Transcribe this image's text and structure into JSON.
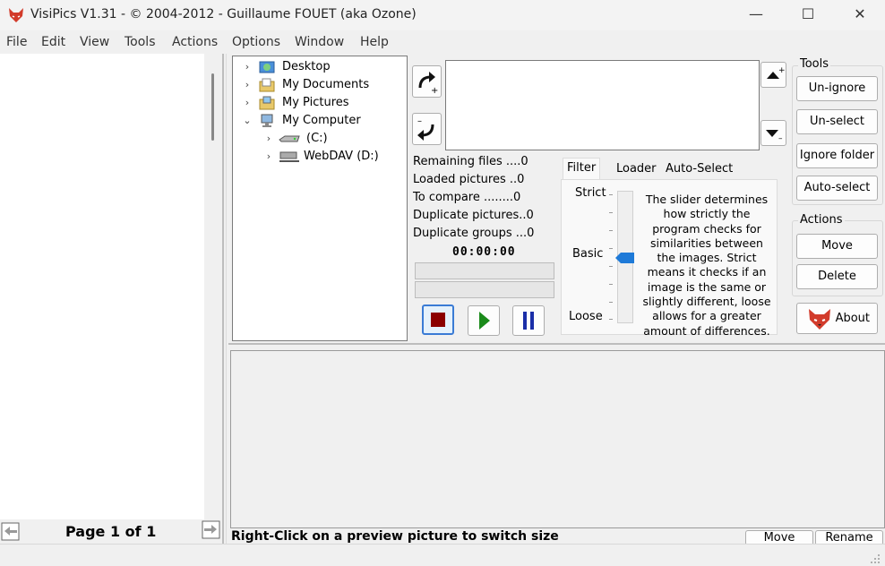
{
  "window": {
    "title": "VisiPics V1.31 - © 2004-2012 - Guillaume FOUET (aka Ozone)",
    "minimize_glyph": "—",
    "maximize_glyph": "☐",
    "close_glyph": "✕"
  },
  "menu": [
    "File",
    "Edit",
    "View",
    "Tools",
    "Actions",
    "Options",
    "Window",
    "Help"
  ],
  "tree": [
    {
      "label": "Desktop",
      "chevron": "›"
    },
    {
      "label": "My Documents",
      "chevron": "›"
    },
    {
      "label": "My Pictures",
      "chevron": "›"
    },
    {
      "label": "My Computer",
      "chevron": "⌄"
    },
    {
      "label": "(C:)",
      "chevron": "›"
    },
    {
      "label": "WebDAV (D:)",
      "chevron": "›"
    }
  ],
  "stats": {
    "remaining": "Remaining files ....0",
    "loaded": "Loaded pictures ..0",
    "compare": "To compare ........0",
    "duplicates": "Duplicate pictures..0",
    "groups": "Duplicate groups ...0",
    "timer": "00:00:00"
  },
  "filter": {
    "tabs": [
      "Filter",
      "Loader",
      "Auto-Select"
    ],
    "levels": {
      "strict": "Strict",
      "basic": "Basic",
      "loose": "Loose"
    },
    "slider_level": "Basic",
    "description": "The slider determines how strictly the program checks for similarities between the images. Strict means it checks if an image is the same or slightly different, loose allows for a greater amount of differences."
  },
  "tools": {
    "label": "Tools",
    "unignore": "Un-ignore",
    "unselect": "Un-select",
    "ignore_folder": "Ignore folder",
    "autoselect": "Auto-select"
  },
  "actions": {
    "label": "Actions",
    "move": "Move",
    "delete": "Delete",
    "about": "About"
  },
  "left_footer": {
    "page": "Page 1 of 1"
  },
  "status": {
    "hint": "Right-Click on a preview picture to switch size",
    "move": "Move",
    "rename": "Rename"
  },
  "colors": {
    "stop": "#8b0000",
    "play": "#1a8a1a",
    "pause": "#1a2ea8",
    "slider_thumb": "#1e7ad8",
    "accent": "#d23b2b"
  }
}
